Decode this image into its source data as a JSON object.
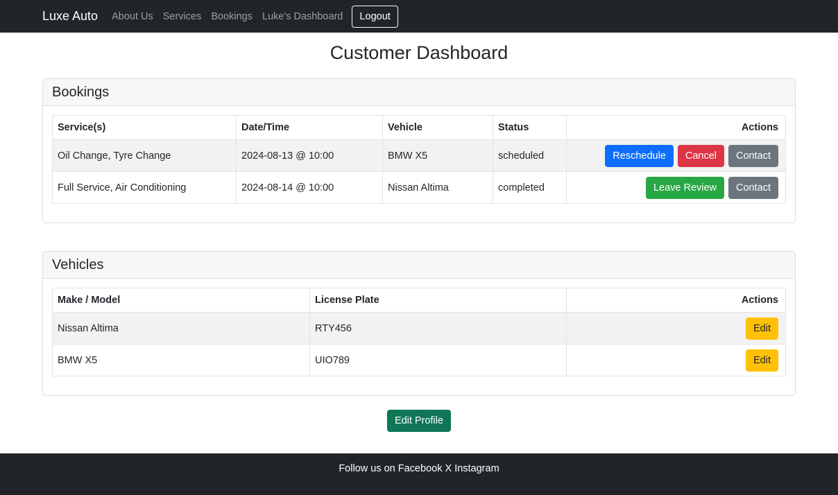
{
  "nav": {
    "brand": "Luxe Auto",
    "links": [
      "About Us",
      "Services",
      "Bookings",
      "Luke's Dashboard"
    ],
    "logout": "Logout"
  },
  "page": {
    "title": "Customer Dashboard"
  },
  "bookings": {
    "title": "Bookings",
    "columns": [
      "Service(s)",
      "Date/Time",
      "Vehicle",
      "Status",
      "Actions"
    ],
    "rows": [
      {
        "services": "Oil Change, Tyre Change",
        "datetime": "2024-08-13 @ 10:00",
        "vehicle": "BMW X5",
        "status": "scheduled",
        "actions": [
          "Reschedule",
          "Cancel",
          "Contact"
        ]
      },
      {
        "services": "Full Service, Air Conditioning",
        "datetime": "2024-08-14 @ 10:00",
        "vehicle": "Nissan Altima",
        "status": "completed",
        "actions": [
          "Leave Review",
          "Contact"
        ]
      }
    ]
  },
  "vehicles": {
    "title": "Vehicles",
    "columns": [
      "Make / Model",
      "License Plate",
      "Actions"
    ],
    "rows": [
      {
        "model": "Nissan Altima",
        "plate": "RTY456",
        "action": "Edit"
      },
      {
        "model": "BMW X5",
        "plate": "UIO789",
        "action": "Edit"
      }
    ]
  },
  "profile": {
    "edit_label": "Edit Profile"
  },
  "footer": {
    "prefix": "Follow us on",
    "links": [
      "Facebook",
      "X",
      "Instagram"
    ]
  },
  "colors": {
    "navbar": "#212529",
    "primary": "#0d6efd",
    "danger": "#dc3545",
    "secondary": "#6c757d",
    "success": "#28a745",
    "warning": "#ffc107",
    "profile": "#0f7657"
  }
}
